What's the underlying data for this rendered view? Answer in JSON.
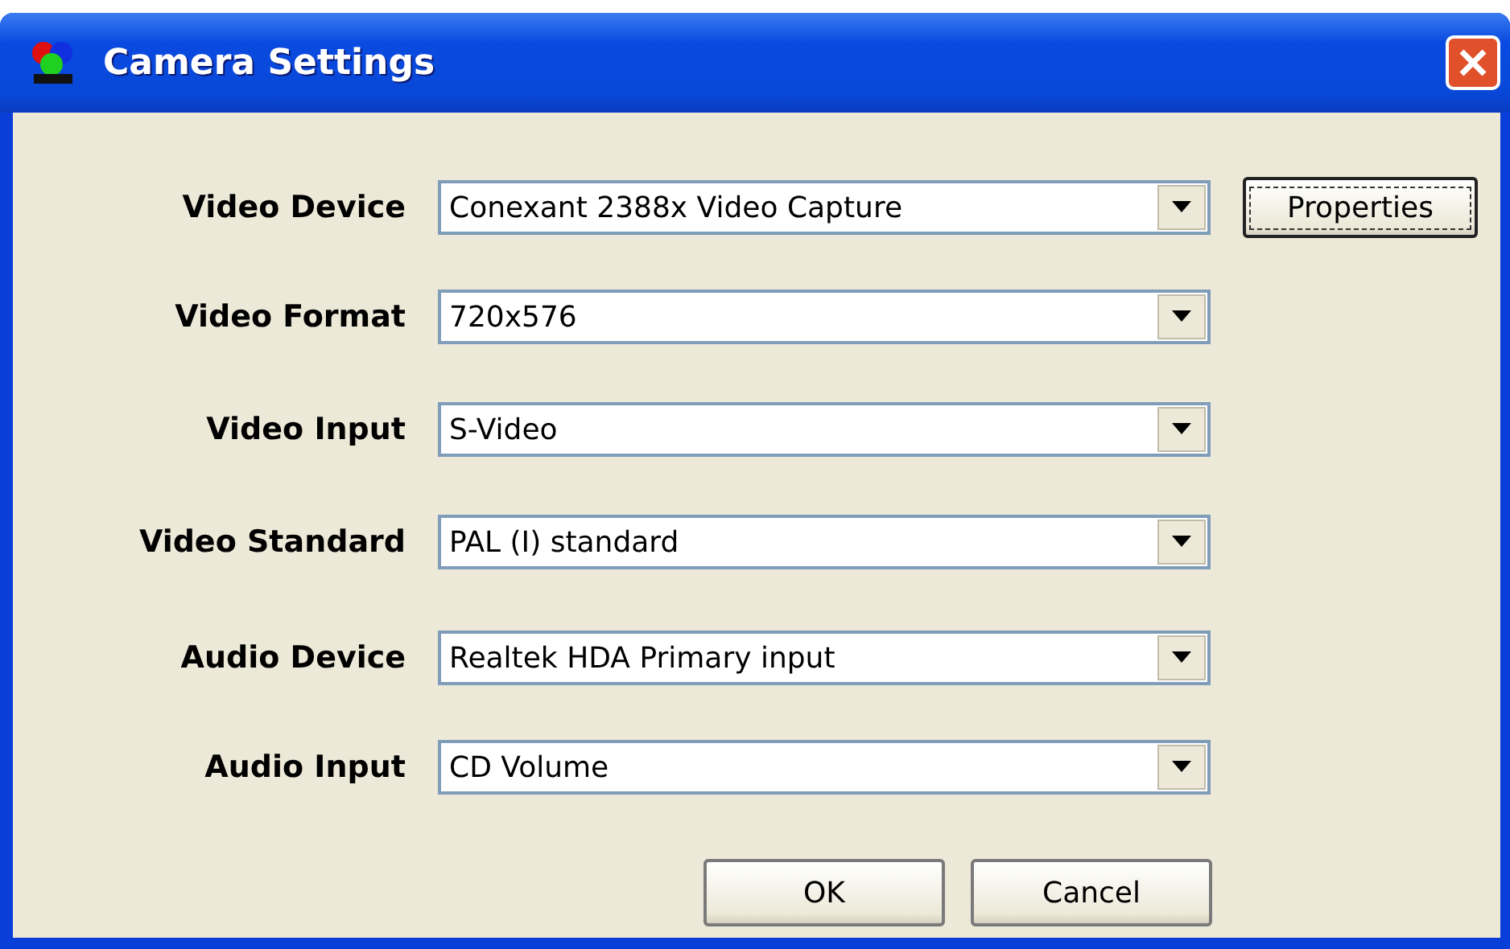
{
  "window": {
    "title": "Camera Settings"
  },
  "fields": [
    {
      "label": "Video Device",
      "value": "Conexant 2388x Video Capture"
    },
    {
      "label": "Video Format",
      "value": "720x576"
    },
    {
      "label": "Video Input",
      "value": "S-Video"
    },
    {
      "label": "Video Standard",
      "value": "PAL (I) standard"
    },
    {
      "label": "Audio Device",
      "value": "Realtek HDA Primary input"
    },
    {
      "label": "Audio Input",
      "value": "CD Volume"
    }
  ],
  "properties_button": {
    "label": "Properties",
    "focused": true
  },
  "buttons": [
    {
      "label": "OK",
      "focused": false
    },
    {
      "label": "Cancel",
      "focused": false
    }
  ]
}
